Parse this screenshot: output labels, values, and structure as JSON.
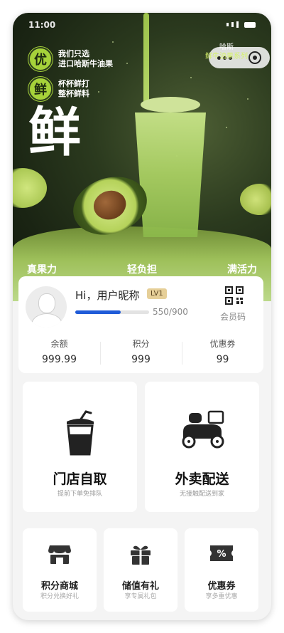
{
  "status_bar": {
    "time": "11:00"
  },
  "hero": {
    "tag1": {
      "char": "优",
      "line1": "我们只选",
      "line2": "进口哈斯牛油果"
    },
    "tag2": {
      "char": "鲜",
      "line1": "杯杯鲜打",
      "line2": "整杯鲜料"
    },
    "big_char": "鲜",
    "brand": {
      "line1": "哈斯",
      "line2": "鲜牛油果系列"
    },
    "features": [
      "真果力",
      "轻负担",
      "满活力"
    ],
    "accent_color": "#a6d23a"
  },
  "user": {
    "greeting": "Hi，用户昵称",
    "level": "LV1",
    "progress_text": "550/900",
    "progress_fraction": 0.611,
    "qr_label": "会员码",
    "stats": [
      {
        "label": "余额",
        "value": "999.99"
      },
      {
        "label": "积分",
        "value": "999"
      },
      {
        "label": "优惠券",
        "value": "99"
      }
    ]
  },
  "services": {
    "pickup": {
      "title": "门店自取",
      "subtitle": "提前下单免排队"
    },
    "delivery": {
      "title": "外卖配送",
      "subtitle": "无接触配送到家"
    }
  },
  "shortcuts": [
    {
      "title": "积分商城",
      "subtitle": "积分兑换好礼",
      "icon": "shop-icon"
    },
    {
      "title": "储值有礼",
      "subtitle": "享专属礼包",
      "icon": "gift-icon"
    },
    {
      "title": "优惠券",
      "subtitle": "享多重优惠",
      "icon": "coupon-icon"
    }
  ]
}
